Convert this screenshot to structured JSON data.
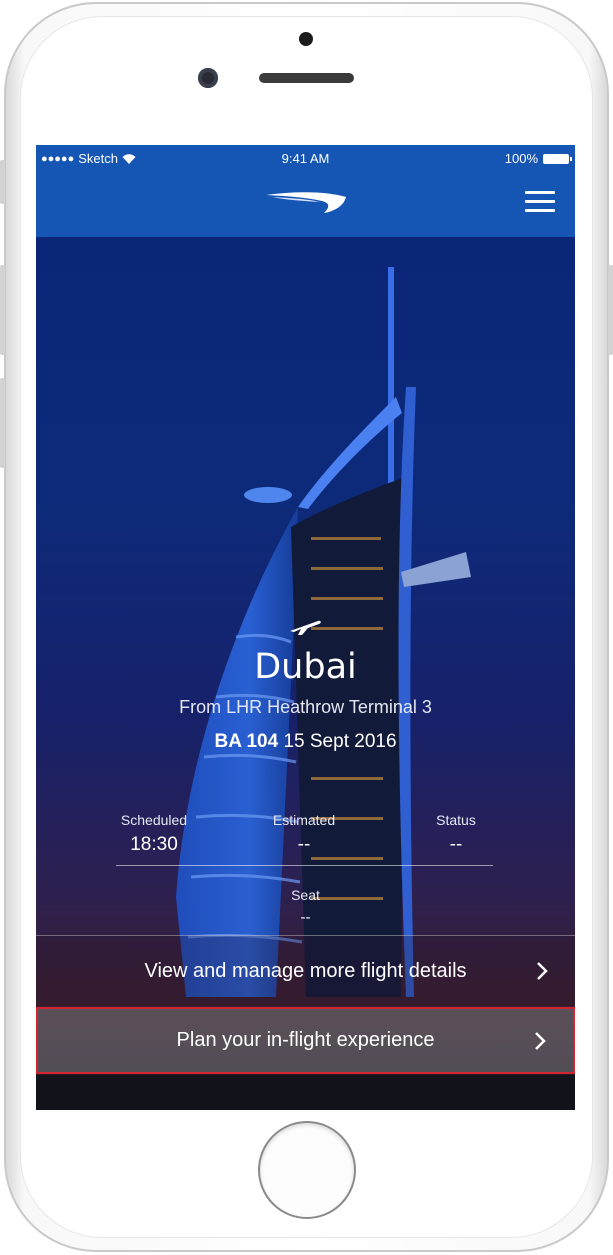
{
  "status_bar": {
    "carrier": "Sketch",
    "time": "9:41 AM",
    "battery": "100%"
  },
  "header": {
    "logo_icon": "ba-speedmarque-icon",
    "menu_icon": "hamburger-menu-icon"
  },
  "flight": {
    "destination": "Dubai",
    "origin_line": "From LHR Heathrow Terminal 3",
    "flight_number": "BA 104",
    "date": "15 Sept 2016"
  },
  "details": {
    "scheduled_label": "Scheduled",
    "scheduled_value": "18:30",
    "estimated_label": "Estimated",
    "estimated_value": "--",
    "status_label": "Status",
    "status_value": "--",
    "seat_label": "Seat",
    "seat_value": "--"
  },
  "actions": {
    "manage_label": "View and manage more flight details",
    "inflight_label": "Plan your in-flight experience"
  },
  "colors": {
    "nav": "#1556b5",
    "highlight_border": "#d3232f"
  }
}
